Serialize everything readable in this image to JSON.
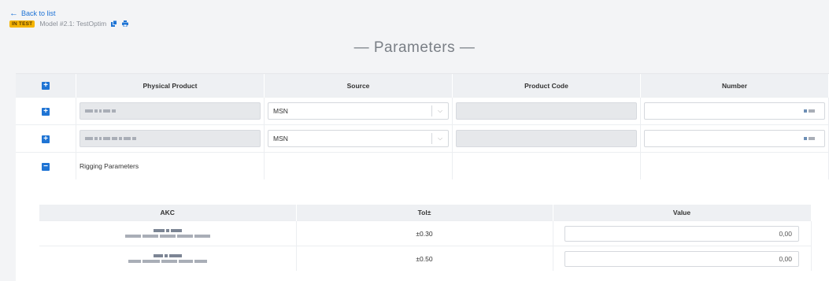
{
  "header": {
    "back_label": "Back to list",
    "badge": "IN TEST",
    "model_name": "Model #2.1: TestOptim"
  },
  "page_title": "— Parameters —",
  "params_table": {
    "columns": [
      "Physical Product",
      "Source",
      "Product Code",
      "Number"
    ],
    "rows": [
      {
        "source": "MSN"
      },
      {
        "source": "MSN"
      }
    ],
    "rigging_label": "Rigging Parameters"
  },
  "rigging_table": {
    "columns": [
      "AKC",
      "Tol±",
      "Value"
    ],
    "rows": [
      {
        "tol": "±0.30",
        "value": "0,00"
      },
      {
        "tol": "±0.50",
        "value": "0,00"
      }
    ]
  },
  "colors": {
    "accent": "#1f74d4",
    "badge": "#f5b400"
  },
  "icons": [
    "back-arrow-icon",
    "copy-icon",
    "print-icon",
    "expand-plus-icon",
    "collapse-minus-icon",
    "chevron-down-icon"
  ]
}
